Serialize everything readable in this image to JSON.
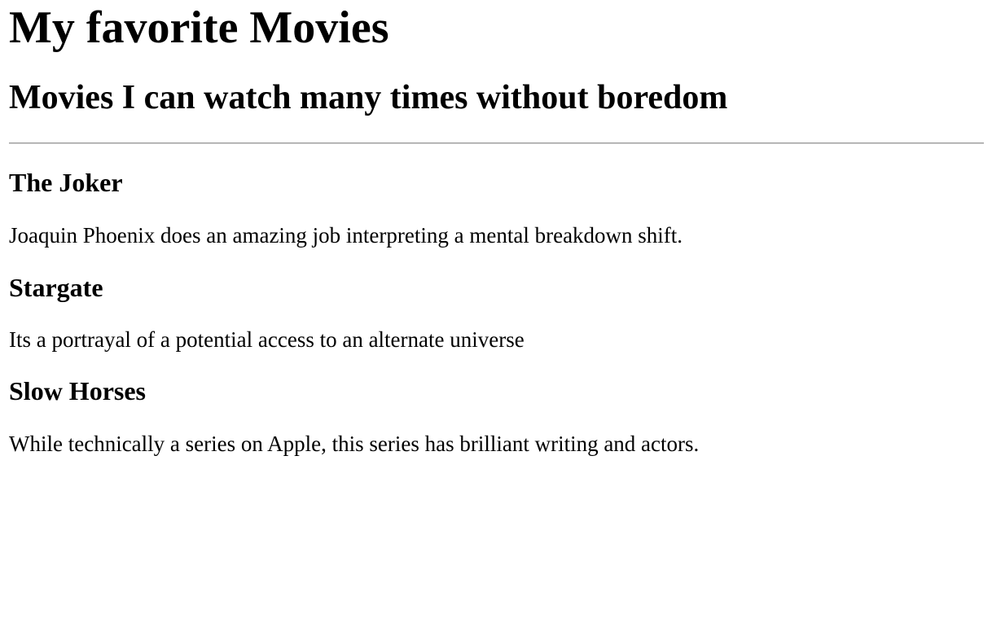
{
  "page": {
    "title": "My favorite Movies",
    "subtitle": "Movies I can watch many times without boredom"
  },
  "movies": [
    {
      "title": "The Joker",
      "description": "Joaquin Phoenix does an amazing job interpreting a mental breakdown shift."
    },
    {
      "title": "Stargate",
      "description": "Its a portrayal of a potential access to an alternate universe"
    },
    {
      "title": "Slow Horses",
      "description": "While technically a series on Apple, this series has brilliant writing and actors."
    }
  ]
}
